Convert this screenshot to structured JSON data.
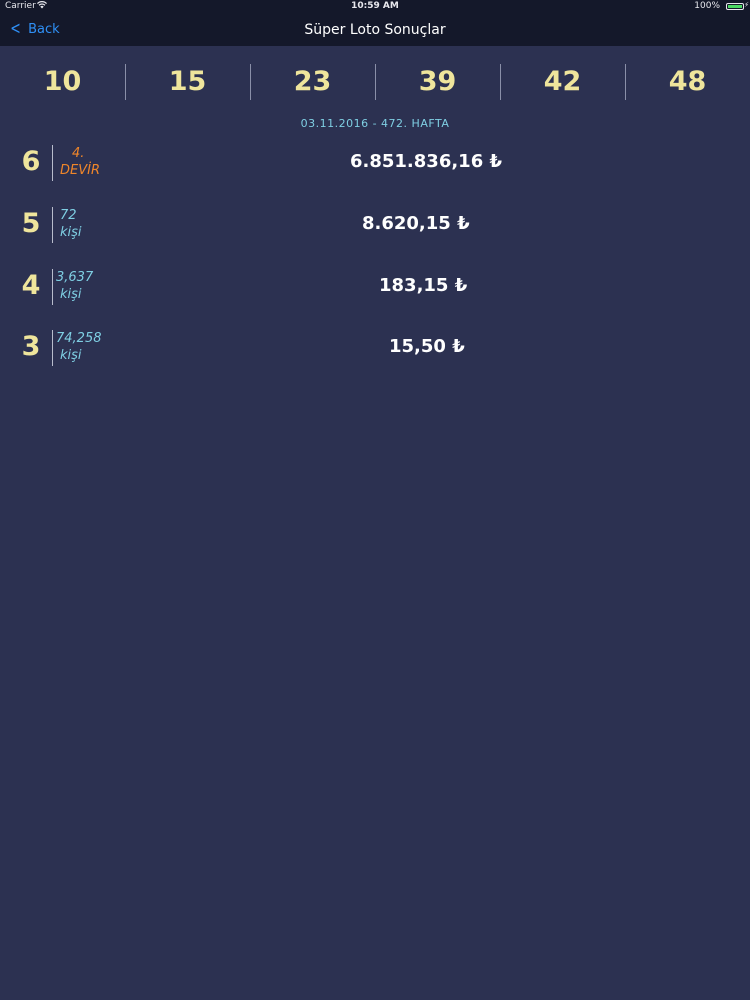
{
  "status_bar": {
    "carrier": "Carrier",
    "time": "10:59 AM",
    "battery_percent": "100%",
    "battery_level": 1.0
  },
  "nav": {
    "back_label": "Back",
    "title": "Süper Loto Sonuçlar"
  },
  "numbers": [
    "10",
    "15",
    "23",
    "39",
    "42",
    "48"
  ],
  "draw_info": "03.11.2016 - 472. HAFTA",
  "prizes": [
    {
      "match": "6",
      "line1": "4.",
      "line2": "DEVİR",
      "amount": "6.851.836,16 ₺",
      "color": "#f0862a"
    },
    {
      "match": "5",
      "line1": "72",
      "line2": "kişi",
      "amount": "8.620,15 ₺",
      "color": "#7fcfe3"
    },
    {
      "match": "4",
      "line1": "3,637",
      "line2": "kişi",
      "amount": "183,15 ₺",
      "color": "#7fcfe3"
    },
    {
      "match": "3",
      "line1": "74,258",
      "line2": "kişi",
      "amount": "15,50 ₺",
      "color": "#7fcfe3"
    }
  ],
  "colors": {
    "background": "#2c3151",
    "bar_background": "#14182a",
    "number_color": "#efe59c",
    "accent_blue": "#2f8ff5",
    "info_blue": "#7fcfe3",
    "info_orange": "#f0862a"
  }
}
